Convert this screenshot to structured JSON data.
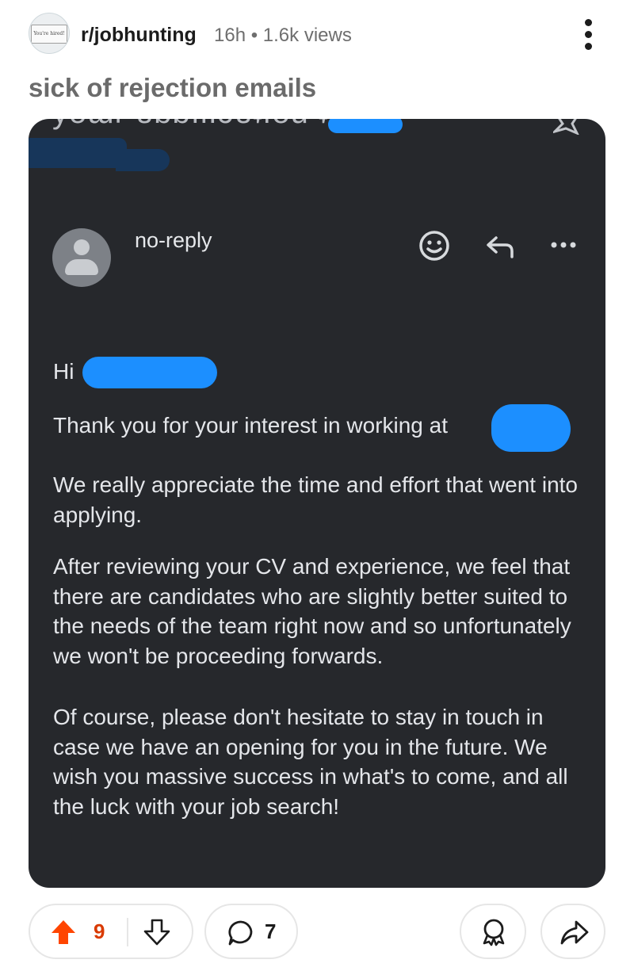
{
  "post": {
    "subreddit_avatar_text": "You're hired!",
    "subreddit": "r/jobhunting",
    "meta": "16h • 1.6k views",
    "title": "sick of rejection emails"
  },
  "email": {
    "sender": "no-reply",
    "greeting": "Hi",
    "paragraphs": [
      "Thank you for your interest in working at",
      "We really appreciate the time and effort that went into applying.",
      "After reviewing your CV and experience, we feel that there are candidates who are slightly better suited to the needs of the team right now and so unfortunately we won't be proceeding forwards.",
      "Of course, please don't hesitate to stay in touch in case we have an opening for you in the future. We wish you massive success in what's to come, and all the luck with your job search!"
    ]
  },
  "actions": {
    "upvotes": "9",
    "comments": "7"
  },
  "colors": {
    "upvote_active": "#ff4500",
    "vote_count": "#d93a00",
    "redaction": "#1c8fff",
    "email_background": "#26282c"
  },
  "icons": [
    "overflow-menu-icon",
    "star-icon",
    "emoji-icon",
    "reply-icon",
    "more-icon",
    "upvote-icon",
    "downvote-icon",
    "comment-icon",
    "award-icon",
    "share-icon"
  ]
}
